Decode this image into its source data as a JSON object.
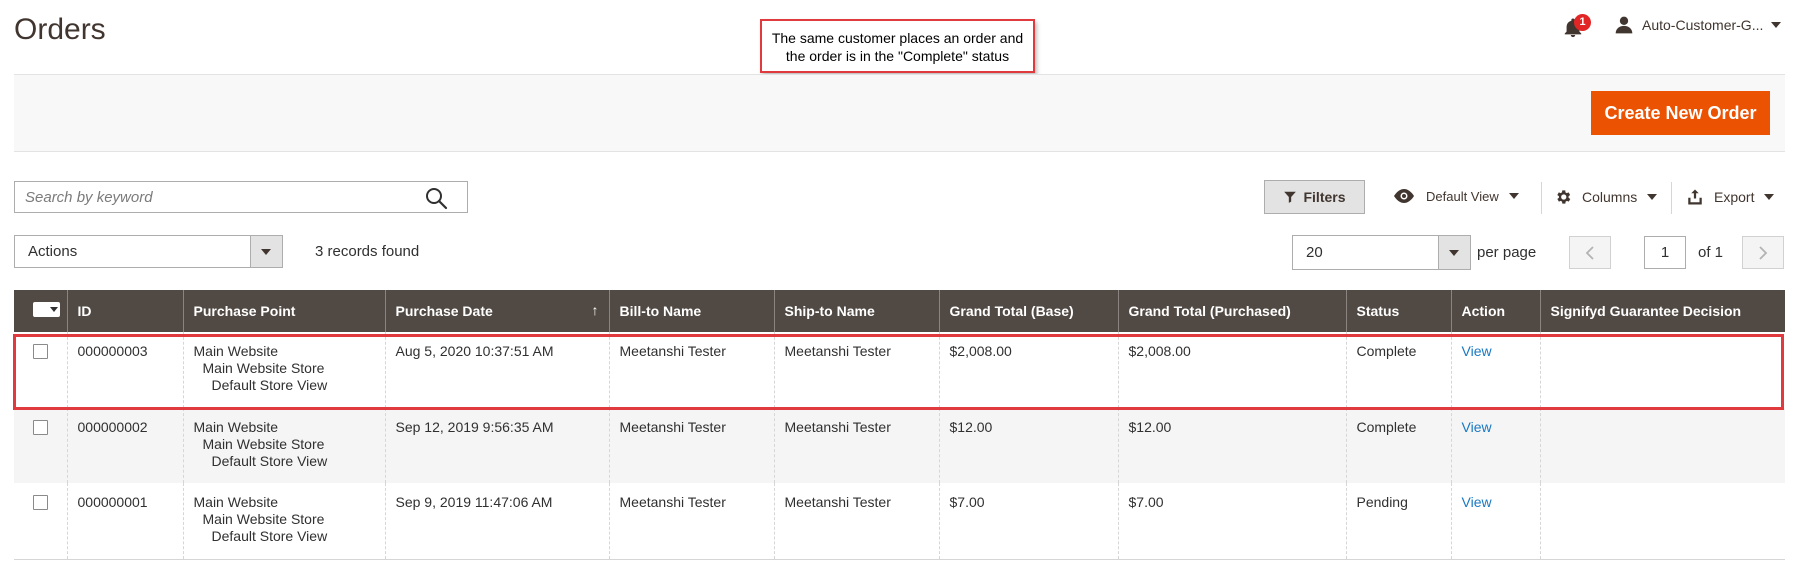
{
  "header": {
    "title": "Orders",
    "notification_count": "1",
    "user_name": "Auto-Customer-G..."
  },
  "callout": {
    "line1": "The same customer places an order and",
    "line2": "the order is in the \"Complete\" status"
  },
  "page_actions": {
    "create_label": "Create New Order"
  },
  "search": {
    "placeholder": "Search by keyword"
  },
  "toolbar": {
    "filters_label": "Filters",
    "view_label": "Default View",
    "columns_label": "Columns",
    "export_label": "Export"
  },
  "mass_actions": {
    "label": "Actions"
  },
  "records_found": "3 records found",
  "pager": {
    "per_page_value": "20",
    "per_page_label": "per page",
    "current_page": "1",
    "of_label": "of 1"
  },
  "table": {
    "columns": [
      "ID",
      "Purchase Point",
      "Purchase Date",
      "Bill-to Name",
      "Ship-to Name",
      "Grand Total (Base)",
      "Grand Total (Purchased)",
      "Status",
      "Action",
      "Signifyd Guarantee Decision"
    ],
    "rows": [
      {
        "id": "000000003",
        "purchase_point": [
          "Main Website",
          "Main Website Store",
          "Default Store View"
        ],
        "purchase_date": "Aug 5, 2020 10:37:51 AM",
        "bill_to": "Meetanshi Tester",
        "ship_to": "Meetanshi Tester",
        "total_base": "$2,008.00",
        "total_purchased": "$2,008.00",
        "status": "Complete",
        "action": "View",
        "signifyd": ""
      },
      {
        "id": "000000002",
        "purchase_point": [
          "Main Website",
          "Main Website Store",
          "Default Store View"
        ],
        "purchase_date": "Sep 12, 2019 9:56:35 AM",
        "bill_to": "Meetanshi Tester",
        "ship_to": "Meetanshi Tester",
        "total_base": "$12.00",
        "total_purchased": "$12.00",
        "status": "Complete",
        "action": "View",
        "signifyd": ""
      },
      {
        "id": "000000001",
        "purchase_point": [
          "Main Website",
          "Main Website Store",
          "Default Store View"
        ],
        "purchase_date": "Sep 9, 2019 11:47:06 AM",
        "bill_to": "Meetanshi Tester",
        "ship_to": "Meetanshi Tester",
        "total_base": "$7.00",
        "total_purchased": "$7.00",
        "status": "Pending",
        "action": "View",
        "signifyd": ""
      }
    ]
  },
  "colors": {
    "accent": "#eb5202",
    "table_header": "#514943",
    "highlight": "#e0393e",
    "link": "#1979c3"
  },
  "icons": [
    "bell-icon",
    "user-icon",
    "search-icon",
    "funnel-icon",
    "eye-icon",
    "gear-icon",
    "export-icon",
    "chevron-left-icon",
    "chevron-right-icon",
    "sort-arrow-up-icon"
  ]
}
